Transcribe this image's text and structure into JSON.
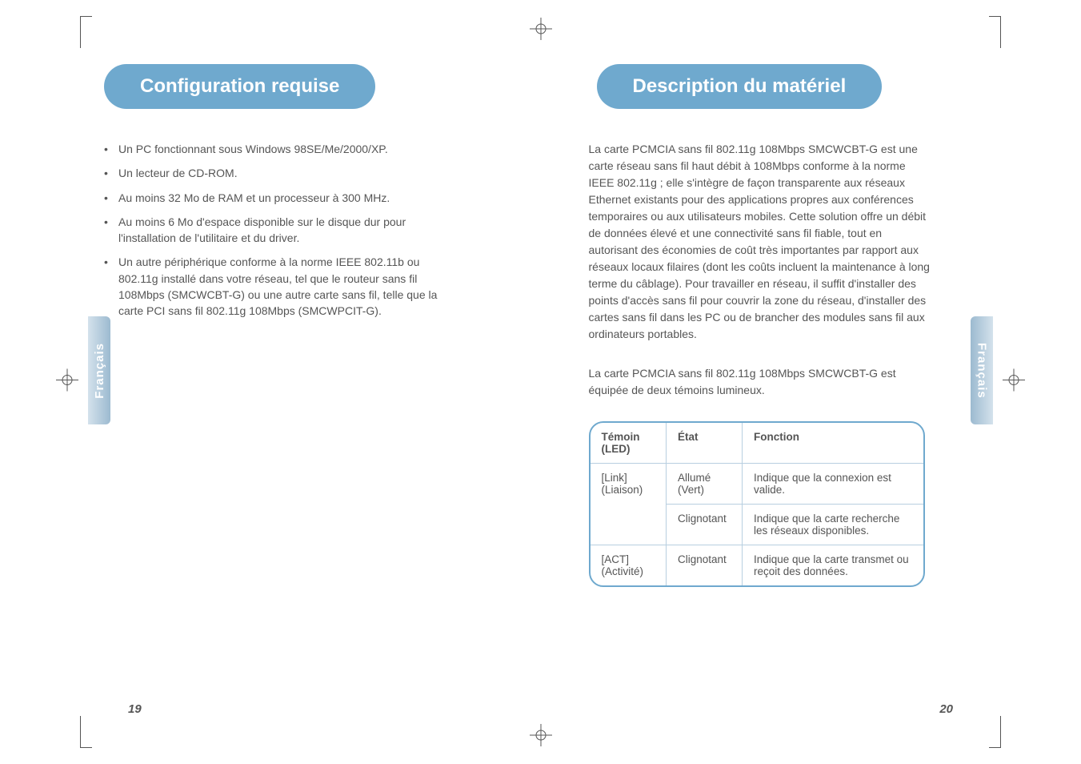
{
  "left": {
    "lang_tab": "Français",
    "heading": "Configuration requise",
    "bullets": [
      "Un PC fonctionnant sous Windows 98SE/Me/2000/XP.",
      "Un lecteur de CD-ROM.",
      "Au moins 32 Mo de RAM et un processeur à 300 MHz.",
      "Au moins 6 Mo d'espace disponible sur le disque dur pour l'installation de l'utilitaire et du driver.",
      "Un autre périphérique conforme à la norme IEEE 802.11b ou 802.11g installé dans votre réseau, tel que le routeur sans fil 108Mbps (SMCWCBT-G) ou une autre carte sans fil, telle que la carte PCI sans fil 802.11g 108Mbps (SMCWPCIT-G)."
    ],
    "pagenum": "19"
  },
  "right": {
    "lang_tab": "Français",
    "heading": "Description du matériel",
    "para1": "La carte PCMCIA sans fil 802.11g 108Mbps SMCWCBT-G est une carte réseau sans fil haut débit à 108Mbps conforme à la norme IEEE 802.11g ; elle s'intègre de façon transparente aux réseaux Ethernet existants pour des applications propres aux conférences temporaires ou aux utilisateurs mobiles. Cette solution offre un débit de données élevé et une connectivité sans fil fiable, tout en autorisant des économies de coût très importantes par rapport aux réseaux locaux filaires (dont les coûts incluent la maintenance à long terme du câblage). Pour travailler en réseau, il suffit d'installer des points d'accès sans fil pour couvrir la zone du réseau, d'installer des cartes sans fil dans les PC ou de brancher des modules sans fil aux ordinateurs portables.",
    "para2": "La carte PCMCIA sans fil 802.11g 108Mbps SMCWCBT-G est équipée de deux témoins lumineux.",
    "table": {
      "headers": {
        "c1": "Témoin (LED)",
        "c2": "État",
        "c3": "Fonction"
      },
      "rows": [
        {
          "c1": "[Link] (Liaison)",
          "c2": "Allumé (Vert)",
          "c3": "Indique que la connexion est valide."
        },
        {
          "c1": "",
          "c2": "Clignotant",
          "c3": "Indique que la carte recherche les réseaux disponibles."
        },
        {
          "c1": "[ACT] (Activité)",
          "c2": "Clignotant",
          "c3": "Indique que la carte transmet ou reçoit des données."
        }
      ]
    },
    "pagenum": "20"
  }
}
